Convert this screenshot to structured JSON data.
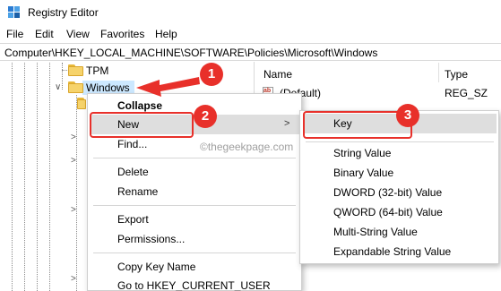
{
  "window": {
    "title": "Registry Editor",
    "icon": "registry-icon"
  },
  "menubar": {
    "items": [
      "File",
      "Edit",
      "View",
      "Favorites",
      "Help"
    ]
  },
  "address": {
    "path": "Computer\\HKEY_LOCAL_MACHINE\\SOFTWARE\\Policies\\Microsoft\\Windows"
  },
  "tree": {
    "nodes": [
      {
        "label": "TPM"
      },
      {
        "label": "Windows"
      }
    ]
  },
  "list": {
    "columns": [
      "Name",
      "Type"
    ],
    "rows": [
      {
        "name": "(Default)",
        "type": "REG_SZ"
      }
    ]
  },
  "context_menu": {
    "items": [
      "Collapse",
      "New",
      "Find...",
      "Delete",
      "Rename",
      "Export",
      "Permissions...",
      "Copy Key Name",
      "Go to HKEY_CURRENT_USER"
    ]
  },
  "submenu": {
    "items": [
      "Key",
      "String Value",
      "Binary Value",
      "DWORD (32-bit) Value",
      "QWORD (64-bit) Value",
      "Multi-String Value",
      "Expandable String Value"
    ]
  },
  "annotations": {
    "badges": [
      "1",
      "2",
      "3"
    ],
    "accent": "#e8302a"
  },
  "watermark": "©thegeekpage.com"
}
